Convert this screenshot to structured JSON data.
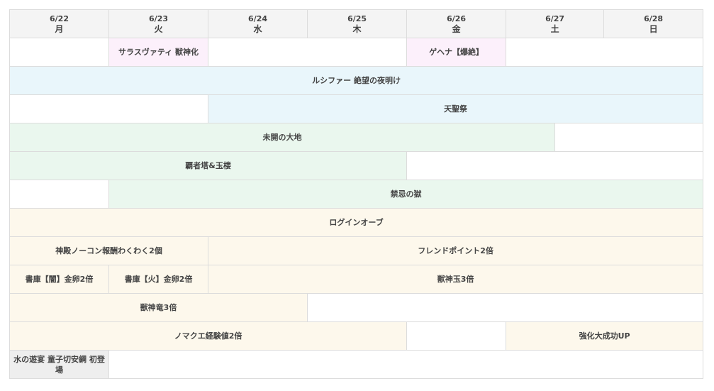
{
  "days": [
    {
      "date": "6/22",
      "weekday": "月"
    },
    {
      "date": "6/23",
      "weekday": "火"
    },
    {
      "date": "6/24",
      "weekday": "水"
    },
    {
      "date": "6/25",
      "weekday": "木"
    },
    {
      "date": "6/26",
      "weekday": "金"
    },
    {
      "date": "6/27",
      "weekday": "土"
    },
    {
      "date": "6/28",
      "weekday": "日"
    }
  ],
  "rows": [
    [
      {
        "text": "",
        "span": 1,
        "color": "empty"
      },
      {
        "text": "サラスヴァティ 獣神化",
        "span": 1,
        "color": "pink"
      },
      {
        "text": "",
        "span": 2,
        "color": "empty"
      },
      {
        "text": "ゲヘナ【爆絶】",
        "span": 1,
        "color": "pink"
      },
      {
        "text": "",
        "span": 2,
        "color": "empty"
      }
    ],
    [
      {
        "text": "ルシファー 絶望の夜明け",
        "span": 7,
        "color": "blue"
      }
    ],
    [
      {
        "text": "",
        "span": 2,
        "color": "empty"
      },
      {
        "text": "天聖祭",
        "span": 5,
        "color": "blue"
      }
    ],
    [
      {
        "text": "未開の大地",
        "span": 5.5,
        "color": "green"
      },
      {
        "text": "",
        "span": 1.5,
        "color": "empty"
      }
    ],
    [
      {
        "text": "覇者塔&玉楼",
        "span": 4,
        "color": "green"
      },
      {
        "text": "",
        "span": 3,
        "color": "empty"
      }
    ],
    [
      {
        "text": "",
        "span": 1,
        "color": "empty"
      },
      {
        "text": "禁忌の獄",
        "span": 6,
        "color": "green"
      }
    ],
    [
      {
        "text": "ログインオーブ",
        "span": 7,
        "color": "cream"
      }
    ],
    [
      {
        "text": "神殿ノーコン報酬わくわく2個",
        "span": 2,
        "color": "cream"
      },
      {
        "text": "フレンドポイント2倍",
        "span": 5,
        "color": "cream"
      }
    ],
    [
      {
        "text": "書庫【闇】金卵2倍",
        "span": 1,
        "color": "cream"
      },
      {
        "text": "書庫【火】金卵2倍",
        "span": 1,
        "color": "cream"
      },
      {
        "text": "獣神玉3倍",
        "span": 5,
        "color": "cream"
      }
    ],
    [
      {
        "text": "獣神竜3倍",
        "span": 3,
        "color": "cream"
      },
      {
        "text": "",
        "span": 4,
        "color": "empty"
      }
    ],
    [
      {
        "text": "ノマクエ経験値2倍",
        "span": 4,
        "color": "cream"
      },
      {
        "text": "",
        "span": 1,
        "color": "empty"
      },
      {
        "text": "強化大成功UP",
        "span": 2,
        "color": "cream"
      }
    ],
    [
      {
        "text": "水の遊宴 童子切安綱 初登場",
        "span": 1,
        "color": "gray"
      },
      {
        "text": "",
        "span": 6,
        "color": "empty"
      }
    ]
  ]
}
